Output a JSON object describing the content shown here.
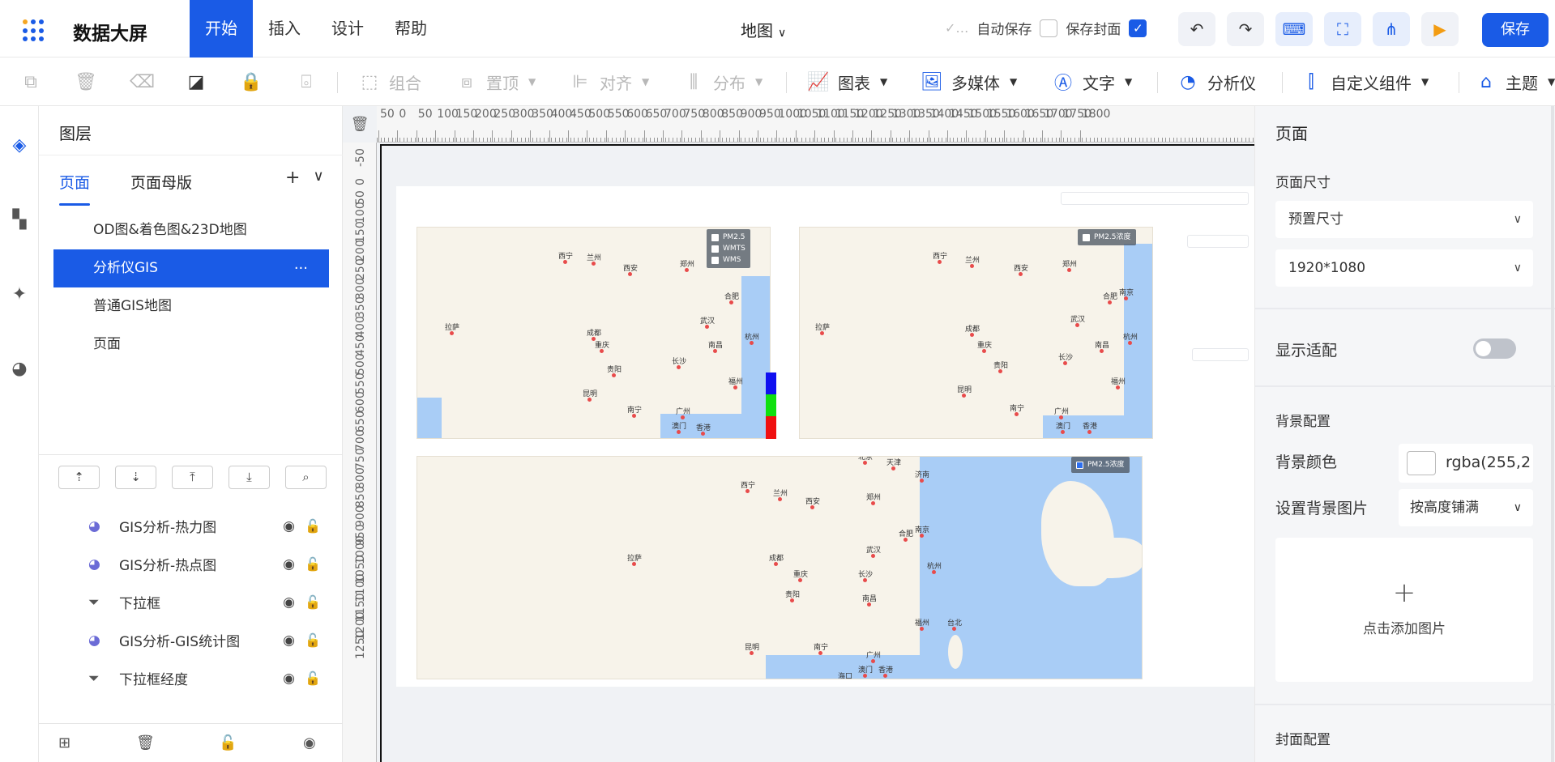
{
  "app": {
    "title": "数据大屏",
    "doc_name": "地图"
  },
  "menu": [
    {
      "label": "开始",
      "active": true
    },
    {
      "label": "插入",
      "active": false
    },
    {
      "label": "设计",
      "active": false
    },
    {
      "label": "帮助",
      "active": false
    }
  ],
  "header": {
    "autosave_label": "自动保存",
    "save_cover_label": "保存封面",
    "save_label": "保存"
  },
  "toolbar": {
    "group": "组合",
    "top": "置顶",
    "align": "对齐",
    "distribute": "分布",
    "chart": "图表",
    "media": "多媒体",
    "text": "文字",
    "analyzer": "分析仪",
    "custom": "自定义组件",
    "theme": "主题"
  },
  "layers": {
    "title": "图层",
    "tabs": [
      {
        "label": "页面",
        "active": true
      },
      {
        "label": "页面母版",
        "active": false
      }
    ],
    "pages": [
      {
        "label": "OD图&着色图&23D地图",
        "active": false
      },
      {
        "label": "分析仪GIS",
        "active": true
      },
      {
        "label": "普通GIS地图",
        "active": false
      },
      {
        "label": "页面",
        "active": false
      }
    ],
    "more": "···",
    "components": [
      {
        "label": "GIS分析-热力图",
        "icon": "pie-icon"
      },
      {
        "label": "GIS分析-热点图",
        "icon": "pie-icon"
      },
      {
        "label": "下拉框",
        "icon": "funnel-icon"
      },
      {
        "label": "GIS分析-GIS统计图",
        "icon": "pie-icon"
      },
      {
        "label": "下拉框经度",
        "icon": "funnel-icon"
      }
    ]
  },
  "canvas": {
    "map1_legend": [
      "PM2.5",
      "WMTS",
      "WMS"
    ],
    "map2_legend": "PM2.5浓度",
    "map3_legend": "PM2.5浓度",
    "colorbar": [
      "#1010f0",
      "#10e010",
      "#f01010"
    ],
    "cities_a": [
      "西宁",
      "兰州",
      "西安",
      "郑州",
      "合肥",
      "武汉",
      "成都",
      "重庆",
      "贵阳",
      "长沙",
      "南昌",
      "杭州",
      "福州",
      "昆明",
      "南宁",
      "广州",
      "澳门",
      "香港",
      "拉萨"
    ],
    "cities_b": [
      "西宁",
      "兰州",
      "西安",
      "郑州",
      "合肥",
      "南京",
      "武汉",
      "成都",
      "重庆",
      "贵阳",
      "长沙",
      "南昌",
      "杭州",
      "福州",
      "昆明",
      "南宁",
      "广州",
      "澳门",
      "香港",
      "拉萨"
    ],
    "cities_c": [
      "北京",
      "天津",
      "济南",
      "西宁",
      "兰州",
      "郑州",
      "西安",
      "合肥",
      "南京",
      "武汉",
      "成都",
      "重庆",
      "贵阳",
      "长沙",
      "南昌",
      "杭州",
      "福州",
      "台北",
      "昆明",
      "南宁",
      "广州",
      "澳门",
      "香港",
      "海口",
      "拉萨"
    ]
  },
  "right_panel": {
    "title": "页面",
    "size_label": "页面尺寸",
    "size_preset": "预置尺寸",
    "size_value": "1920*1080",
    "adapt_label": "显示适配",
    "bg_section": "背景配置",
    "bg_color_label": "背景颜色",
    "bg_color_value": "rgba(255,2",
    "bg_image_label": "设置背景图片",
    "bg_image_mode": "按高度铺满",
    "add_image": "点击添加图片",
    "cover_section": "封面配置"
  },
  "colors": {
    "accent": "#1a5be6"
  }
}
